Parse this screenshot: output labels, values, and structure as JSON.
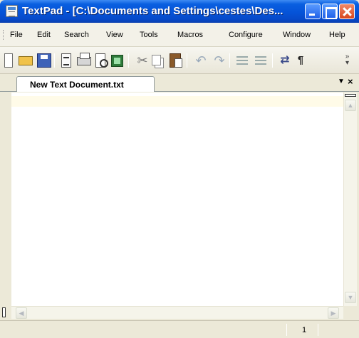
{
  "window": {
    "title": "TextPad - [C:\\Documents and Settings\\cestes\\Des..."
  },
  "menu": {
    "items": [
      {
        "label": "File"
      },
      {
        "label": "Edit"
      },
      {
        "label": "Search"
      },
      {
        "label": "View"
      },
      {
        "label": "Tools"
      },
      {
        "label": "Macros"
      },
      {
        "label": "Configure"
      },
      {
        "label": "Window"
      },
      {
        "label": "Help"
      }
    ]
  },
  "toolbar": {
    "buttons": [
      {
        "icon": "new-document-icon"
      },
      {
        "icon": "open-folder-icon"
      },
      {
        "icon": "save-disk-icon"
      },
      {
        "icon": "document-properties-icon"
      },
      {
        "icon": "printer-icon"
      },
      {
        "icon": "print-preview-icon"
      },
      {
        "icon": "green-view-icon"
      },
      {
        "icon": "scissors-icon"
      },
      {
        "icon": "copy-icon"
      },
      {
        "icon": "paste-icon"
      },
      {
        "icon": "undo-icon"
      },
      {
        "icon": "redo-icon"
      },
      {
        "icon": "indent-icon"
      },
      {
        "icon": "outdent-icon"
      },
      {
        "icon": "word-wrap-icon"
      },
      {
        "icon": "pilcrow-icon"
      },
      {
        "icon": "toolbar-overflow-icon"
      }
    ]
  },
  "tabs": {
    "active_label": "New Text Document.txt",
    "menu_glyph": "▼",
    "close_glyph": "×"
  },
  "editor": {
    "content": ""
  },
  "scrollbar": {
    "up_glyph": "▲",
    "down_glyph": "▼",
    "left_glyph": "◀",
    "right_glyph": "▶"
  },
  "status": {
    "line": "1"
  },
  "colors": {
    "titlebar": "#0553d8",
    "chrome": "#ece9d8",
    "current_line": "#fffbe8",
    "close_button": "#d9461d"
  }
}
